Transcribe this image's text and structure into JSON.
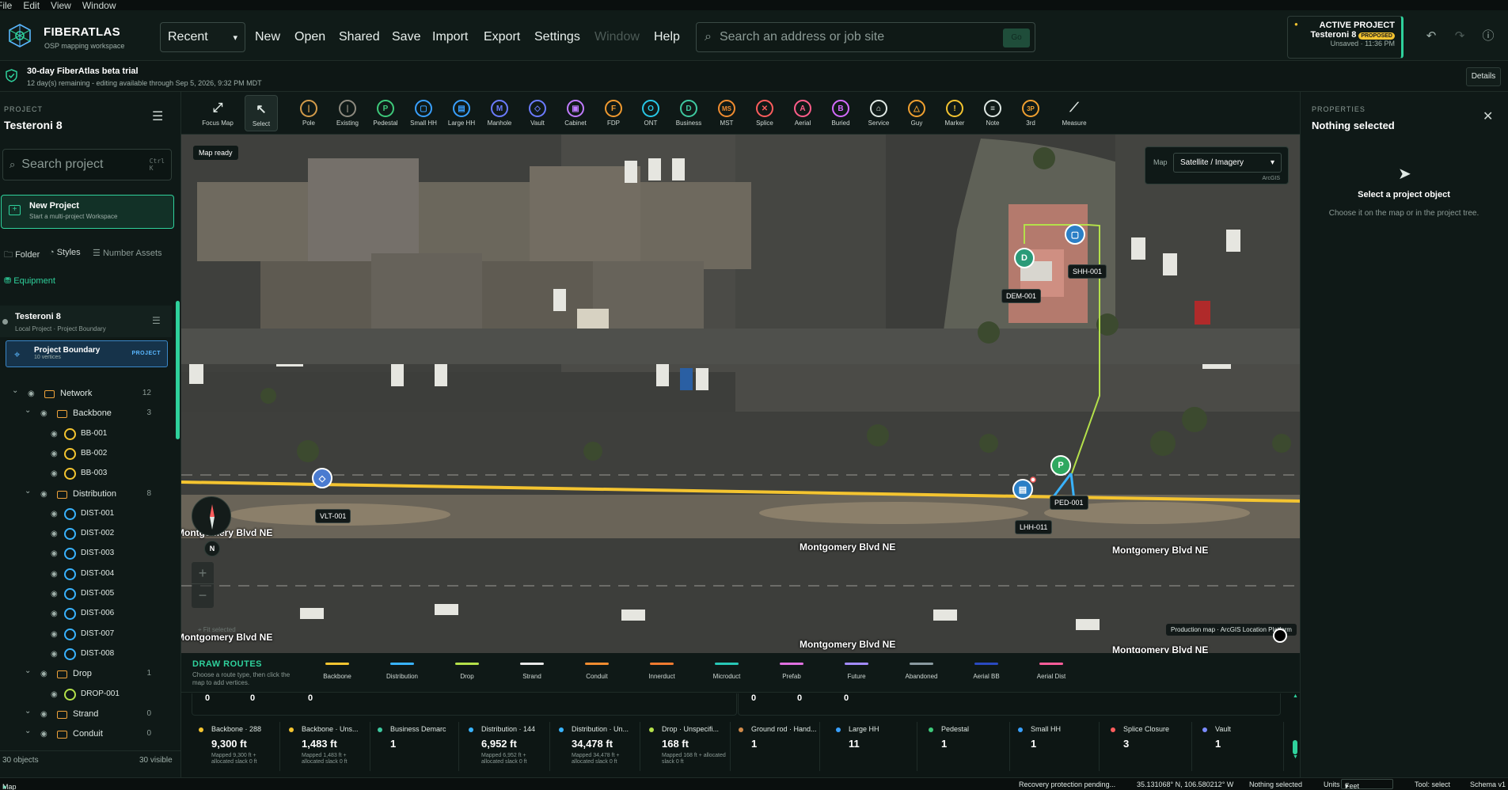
{
  "menu": [
    "File",
    "Edit",
    "View",
    "Window"
  ],
  "brand": {
    "name": "FIBERATLAS",
    "subtitle": "OSP mapping workspace"
  },
  "header": {
    "recent": "Recent",
    "buttons": [
      "New",
      "Open",
      "Shared",
      "Save",
      "Import",
      "Export",
      "Settings",
      "Window",
      "Help"
    ],
    "search_placeholder": "Search an address or job site",
    "go": "Go"
  },
  "active_project": {
    "label": "ACTIVE PROJECT",
    "name": "Testeroni 8",
    "badge": "PROPOSED",
    "saved": "Unsaved · 11:36 PM"
  },
  "trial": {
    "title": "30-day FiberAtlas beta trial",
    "sub": "12 day(s) remaining - editing available through Sep 5, 2026, 9:32 PM MDT",
    "details": "Details"
  },
  "left": {
    "section": "PROJECT",
    "project": "Testeroni 8",
    "search_placeholder": "Search project",
    "kbd": "Ctrl\nK",
    "new_project": "New Project",
    "new_project_sub": "Start a multi-project Workspace",
    "folder": "Folder",
    "styles": "Styles",
    "number_assets": "Number Assets",
    "equipment": "Equipment",
    "card_title": "Testeroni 8",
    "card_sub": "Local Project · Project Boundary",
    "boundary": "Project Boundary",
    "boundary_sub": "10 vertices",
    "boundary_badge": "PROJECT",
    "footer_objects": "30 objects",
    "footer_visible": "30 visible"
  },
  "tree": [
    {
      "label": "Network",
      "count": "12",
      "level": 0,
      "type": "folder",
      "chev": true
    },
    {
      "label": "Backbone",
      "count": "3",
      "level": 1,
      "type": "folder",
      "chev": true
    },
    {
      "label": "BB-001",
      "level": 2,
      "type": "item",
      "color": "#f4c430"
    },
    {
      "label": "BB-002",
      "level": 2,
      "type": "item",
      "color": "#f4c430"
    },
    {
      "label": "BB-003",
      "level": 2,
      "type": "item",
      "color": "#f4c430"
    },
    {
      "label": "Distribution",
      "count": "8",
      "level": 1,
      "type": "folder",
      "chev": true
    },
    {
      "label": "DIST-001",
      "level": 2,
      "type": "item",
      "color": "#39b3ff"
    },
    {
      "label": "DIST-002",
      "level": 2,
      "type": "item",
      "color": "#39b3ff"
    },
    {
      "label": "DIST-003",
      "level": 2,
      "type": "item",
      "color": "#39b3ff"
    },
    {
      "label": "DIST-004",
      "level": 2,
      "type": "item",
      "color": "#39b3ff"
    },
    {
      "label": "DIST-005",
      "level": 2,
      "type": "item",
      "color": "#39b3ff"
    },
    {
      "label": "DIST-006",
      "level": 2,
      "type": "item",
      "color": "#39b3ff"
    },
    {
      "label": "DIST-007",
      "level": 2,
      "type": "item",
      "color": "#39b3ff"
    },
    {
      "label": "DIST-008",
      "level": 2,
      "type": "item",
      "color": "#39b3ff"
    },
    {
      "label": "Drop",
      "count": "1",
      "level": 1,
      "type": "folder",
      "chev": true
    },
    {
      "label": "DROP-001",
      "level": 2,
      "type": "item",
      "color": "#b4e04a"
    },
    {
      "label": "Strand",
      "count": "0",
      "level": 1,
      "type": "folder",
      "chev": true
    },
    {
      "label": "Conduit",
      "count": "0",
      "level": 1,
      "type": "folder",
      "chev": true
    }
  ],
  "tools": [
    {
      "label": "Focus Map",
      "icon": "⤢",
      "color": "#dfe8e4",
      "ring": false
    },
    {
      "label": "Select",
      "icon": "↖",
      "color": "#dfe8e4",
      "ring": false,
      "sel": true
    },
    {
      "label": "Pole",
      "icon": "|",
      "color": "#d39b4a"
    },
    {
      "label": "Existing",
      "icon": "|",
      "color": "#8d8a7f"
    },
    {
      "label": "Pedestal",
      "icon": "P",
      "color": "#3ec97a"
    },
    {
      "label": "Small HH",
      "icon": "▢",
      "color": "#39a0ff"
    },
    {
      "label": "Large HH",
      "icon": "▤",
      "color": "#39a0ff"
    },
    {
      "label": "Manhole",
      "icon": "M",
      "color": "#6b7bff"
    },
    {
      "label": "Vault",
      "icon": "◇",
      "color": "#6b7bff"
    },
    {
      "label": "Cabinet",
      "icon": "▣",
      "color": "#c07bff"
    },
    {
      "label": "FDP",
      "icon": "F",
      "color": "#f09a30"
    },
    {
      "label": "ONT",
      "icon": "O",
      "color": "#28c7e6"
    },
    {
      "label": "Business",
      "icon": "D",
      "color": "#3ec9a0"
    },
    {
      "label": "MST",
      "icon": "MS",
      "color": "#f08c30"
    },
    {
      "label": "Splice",
      "icon": "✕",
      "color": "#ff5d5d"
    },
    {
      "label": "Aerial",
      "icon": "A",
      "color": "#ff5d8a"
    },
    {
      "label": "Buried",
      "icon": "B",
      "color": "#d46bff"
    },
    {
      "label": "Service",
      "icon": "⌂",
      "color": "#dfe8e4"
    },
    {
      "label": "Guy",
      "icon": "△",
      "color": "#f0a030"
    },
    {
      "label": "Marker",
      "icon": "!",
      "color": "#f4c430"
    },
    {
      "label": "Note",
      "icon": "≡",
      "color": "#dfe8e4"
    },
    {
      "label": "3rd",
      "icon": "3P",
      "color": "#f0a030"
    },
    {
      "label": "Measure",
      "icon": "⟋",
      "color": "#dfe8e4",
      "ring": false
    }
  ],
  "map": {
    "ready": "Map ready",
    "map_label": "Map",
    "basemap": "Satellite / Imagery",
    "source": "ArcGIS",
    "attribution": "Production map · ArcGIS Location Platform",
    "compass": "N",
    "fit": "Fit selected",
    "streets": [
      "Montgomery Blvd NE",
      "Montgomery Blvd NE",
      "Montgomery Blvd NE",
      "Montgomery Blvd NE",
      "Montgomery Blvd NE",
      "Montgomery Blvd NE"
    ],
    "nodes": [
      {
        "id": "VLT-001",
        "icon": "◇",
        "color": "#4a7bd0"
      },
      {
        "id": "LHH-011",
        "icon": "▤",
        "color": "#2b7fc6"
      },
      {
        "id": "PED-001",
        "icon": "P",
        "color": "#2fa860"
      },
      {
        "id": "DEM-001",
        "icon": "D",
        "color": "#2a9a78"
      },
      {
        "id": "SHH-001",
        "icon": "▢",
        "color": "#2b7fc6"
      }
    ]
  },
  "draw_routes": {
    "title": "DRAW ROUTES",
    "sub": "Choose a route type, then click the map to add vertices.",
    "routes": [
      {
        "label": "Backbone",
        "color": "#f4c430"
      },
      {
        "label": "Distribution",
        "color": "#39b3ff"
      },
      {
        "label": "Drop",
        "color": "#b4e04a"
      },
      {
        "label": "Strand",
        "color": "#e8e8e8"
      },
      {
        "label": "Conduit",
        "color": "#f08c30"
      },
      {
        "label": "Innerduct",
        "color": "#f07a30"
      },
      {
        "label": "Microduct",
        "color": "#28c7b6"
      },
      {
        "label": "Prefab",
        "color": "#e070e0"
      },
      {
        "label": "Future",
        "color": "#a38bff"
      },
      {
        "label": "Abandoned",
        "color": "#8a9aa0"
      },
      {
        "label": "Aerial BB",
        "color": "#2a4ac0"
      },
      {
        "label": "Aerial Dist",
        "color": "#ff5d9a"
      }
    ]
  },
  "zeros": [
    "0",
    "0",
    "0",
    "0",
    "0",
    "0"
  ],
  "stats": [
    {
      "label": "Backbone · 288",
      "value": "9,300 ft",
      "sub": "Mapped 9,300 ft + allocated slack 0 ft",
      "color": "#f4c430"
    },
    {
      "label": "Backbone · Uns...",
      "value": "1,483 ft",
      "sub": "Mapped 1,483 ft + allocated slack 0 ft",
      "color": "#f4c430"
    },
    {
      "label": "Business Demarc",
      "value": "1",
      "sub": "",
      "color": "#3ec9a0"
    },
    {
      "label": "Distribution · 144",
      "value": "6,952 ft",
      "sub": "Mapped 6,952 ft + allocated slack 0 ft",
      "color": "#39b3ff"
    },
    {
      "label": "Distribution · Un...",
      "value": "34,478 ft",
      "sub": "Mapped 34,478 ft + allocated slack 0 ft",
      "color": "#39b3ff"
    },
    {
      "label": "Drop · Unspecifi...",
      "value": "168 ft",
      "sub": "Mapped 168 ft + allocated slack 0 ft",
      "color": "#b4e04a"
    },
    {
      "label": "Ground rod · Hand...",
      "value": "1",
      "sub": "",
      "color": "#d08a4a"
    },
    {
      "label": "Large HH",
      "value": "11",
      "sub": "",
      "color": "#39a0ff"
    },
    {
      "label": "Pedestal",
      "value": "1",
      "sub": "",
      "color": "#3ec97a"
    },
    {
      "label": "Small HH",
      "value": "1",
      "sub": "",
      "color": "#39a0ff"
    },
    {
      "label": "Splice Closure",
      "value": "3",
      "sub": "",
      "color": "#ff5d5d"
    },
    {
      "label": "Vault",
      "value": "1",
      "sub": "",
      "color": "#7b8bff"
    }
  ],
  "right": {
    "section": "PROPERTIES",
    "title": "Nothing selected",
    "heading": "Select a project object",
    "desc": "Choose it on the map or in the project tree."
  },
  "status": {
    "left": "Map connected",
    "recovery": "Recovery protection pending...",
    "coords": "35.131068° N, 106.580212° W",
    "selection": "Nothing selected",
    "units_label": "Units",
    "units": "Feet",
    "tool": "Tool: select",
    "schema": "Schema v1"
  }
}
